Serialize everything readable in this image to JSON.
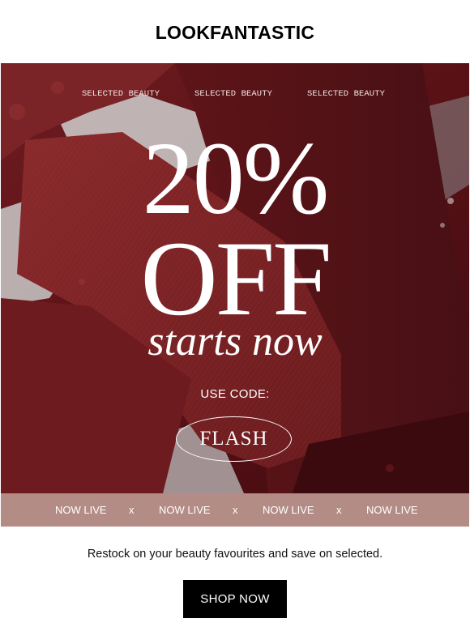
{
  "header": {
    "logo_text": "LOOKFANTASTIC"
  },
  "hero": {
    "taglines": [
      "SELECTED BEAUTY",
      "SELECTED BEAUTY",
      "SELECTED BEAUTY"
    ],
    "headline_percent": "20%",
    "headline_off": "OFF",
    "headline_sub": "starts now",
    "code_label": "USE CODE:",
    "code_value": "FLASH"
  },
  "ticker": {
    "items": [
      "NOW LIVE",
      "x",
      "NOW LIVE",
      "x",
      "NOW LIVE",
      "x",
      "NOW LIVE"
    ]
  },
  "body": {
    "text": "Restock on your beauty favourites and save on selected."
  },
  "cta": {
    "label": "SHOP NOW"
  },
  "colors": {
    "hero_base": "#5c1318",
    "ticker_band": "#b48c86",
    "cta_background": "#000000"
  }
}
